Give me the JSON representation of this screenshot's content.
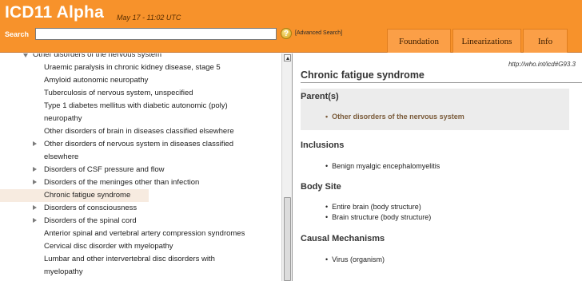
{
  "header": {
    "app_title": "ICD11 Alpha",
    "timestamp": "May 17 - 11:02 UTC",
    "search_label": "Search",
    "search_value": "",
    "help_icon": "help-icon",
    "advanced_link": "[Advanced Search]",
    "tabs": [
      {
        "label": "Foundation"
      },
      {
        "label": "Linearizations"
      },
      {
        "label": "Info"
      }
    ],
    "accent_color": "#f7922b"
  },
  "tree": {
    "items": [
      {
        "label": "Other disorders of the nervous system",
        "expanded": true
      },
      {
        "label": "Uraemic paralysis in chronic kidney disease, stage 5"
      },
      {
        "label": "Amyloid autonomic neuropathy"
      },
      {
        "label": "Tuberculosis of nervous system, unspecified"
      },
      {
        "label": "Type 1 diabetes mellitus with diabetic autonomic (poly)",
        "cont": "neuropathy"
      },
      {
        "label": "Other disorders of brain in diseases classified elsewhere"
      },
      {
        "label": "Other disorders of nervous system in diseases classified",
        "cont": "elsewhere",
        "has_children": true
      },
      {
        "label": "Disorders of CSF pressure and flow",
        "has_children": true
      },
      {
        "label": "Disorders of the meninges other than infection",
        "has_children": true
      },
      {
        "label": "Chronic fatigue syndrome",
        "selected": true
      },
      {
        "label": "Disorders of consciousness",
        "has_children": true
      },
      {
        "label": "Disorders of the spinal cord",
        "has_children": true
      },
      {
        "label": "Anterior spinal and vertebral artery compression syndromes"
      },
      {
        "label": "Cervical disc disorder with myelopathy"
      },
      {
        "label": "Lumbar and other intervertebral disc disorders with",
        "cont": "myelopathy"
      }
    ]
  },
  "detail": {
    "uri": "http://who.int/icd#G93.3",
    "title": "Chronic fatigue syndrome",
    "parent_heading": "Parent(s)",
    "parent_link": "Other disorders of the nervous system",
    "inclusions_heading": "Inclusions",
    "inclusions": [
      "Benign myalgic encephalomyelitis"
    ],
    "body_site_heading": "Body Site",
    "body_sites": [
      "Entire brain (body structure)",
      "Brain structure (body structure)"
    ],
    "causal_heading": "Causal Mechanisms",
    "causal": [
      "Virus (organism)"
    ]
  }
}
